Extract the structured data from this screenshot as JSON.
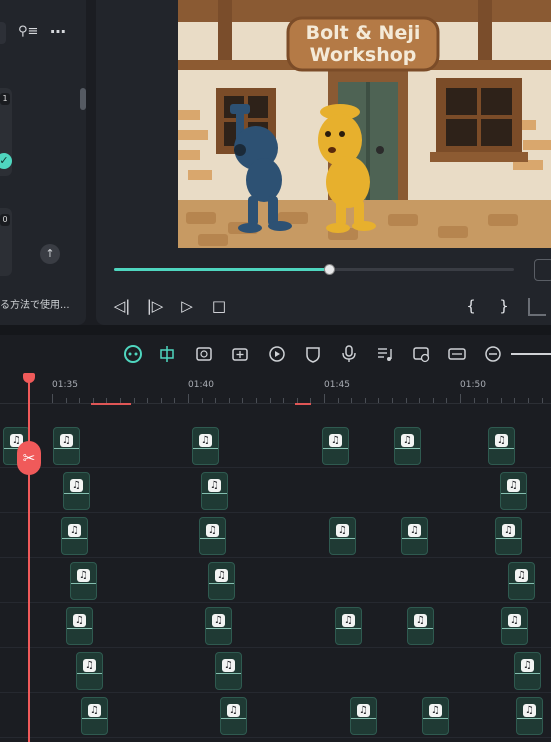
{
  "left_panel": {
    "badge_top": "1",
    "badge_mid": "0",
    "footer_text": "る方法で使用...",
    "filter_icon": "filter-icon",
    "more_icon": "more-icon"
  },
  "preview": {
    "sign_line1": "Bolt & Neji",
    "sign_line2": "Workshop",
    "progress": 0.54,
    "colors": {
      "accent": "#4fd6bf",
      "playhead": "#f05a5a"
    }
  },
  "player_controls": {
    "prev_frame": "◁|",
    "next_frame": "|▷",
    "play": "▷",
    "stop": "□",
    "mark_in": "{",
    "mark_out": "}"
  },
  "toolbar": {
    "icons": [
      "ai-assistant-icon",
      "auto-cut-icon",
      "media-icon",
      "add-media-icon",
      "speed-icon",
      "mask-icon",
      "microphone-icon",
      "music-list-icon",
      "screen-record-icon",
      "fit-width-icon",
      "zoom-out-icon"
    ]
  },
  "ruler": {
    "labels": [
      "01:35",
      "01:40",
      "01:45",
      "01:50"
    ]
  }
}
